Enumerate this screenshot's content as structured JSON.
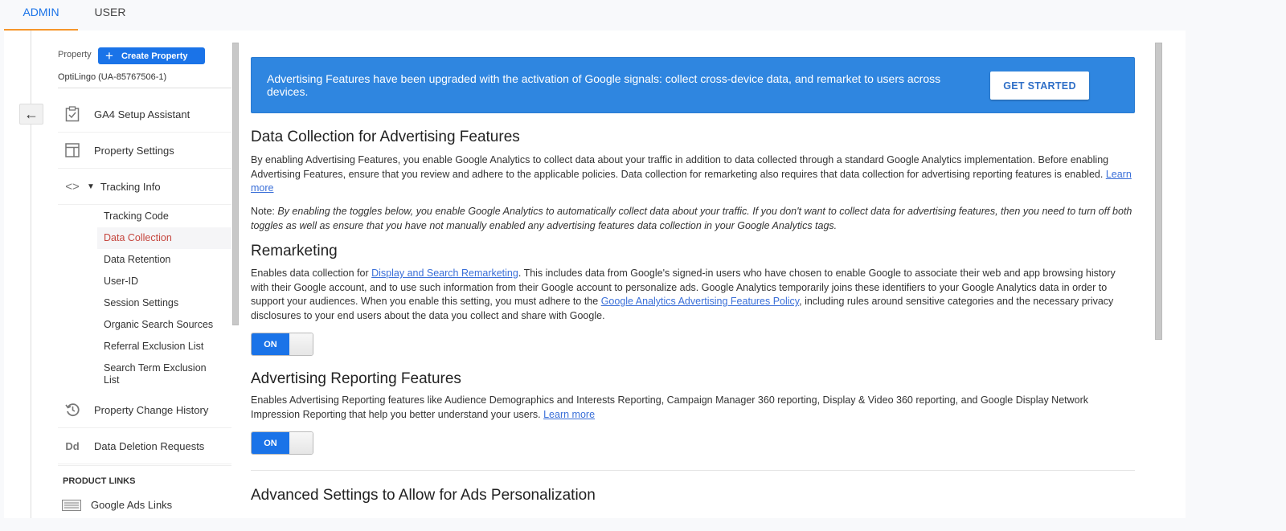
{
  "tabs": [
    {
      "label": "ADMIN",
      "active": true
    },
    {
      "label": "USER",
      "active": false
    }
  ],
  "sidebar": {
    "property_label": "Property",
    "create_button": "Create Property",
    "property_name": "OptiLingo (UA-85767506-1)",
    "items": [
      {
        "label": "GA4 Setup Assistant",
        "icon": "clipboard-check-icon"
      },
      {
        "label": "Property Settings",
        "icon": "layout-icon"
      },
      {
        "label": "Tracking Info",
        "icon": "code-icon",
        "expanded": true
      },
      {
        "label": "Property Change History",
        "icon": "history-icon"
      },
      {
        "label": "Data Deletion Requests",
        "icon": "dd-icon",
        "icon_text": "Dd"
      }
    ],
    "tracking_subitems": [
      {
        "label": "Tracking Code",
        "active": false
      },
      {
        "label": "Data Collection",
        "active": true
      },
      {
        "label": "Data Retention",
        "active": false
      },
      {
        "label": "User-ID",
        "active": false
      },
      {
        "label": "Session Settings",
        "active": false
      },
      {
        "label": "Organic Search Sources",
        "active": false
      },
      {
        "label": "Referral Exclusion List",
        "active": false
      },
      {
        "label": "Search Term Exclusion List",
        "active": false
      }
    ],
    "section_label": "PRODUCT LINKS",
    "product_links": [
      {
        "label": "Google Ads Links",
        "icon": "ads-links-icon"
      }
    ]
  },
  "banner": {
    "text": "Advertising Features have been upgraded with the activation of Google signals: collect cross-device data, and remarket to users across devices.",
    "button": "GET STARTED"
  },
  "sections": {
    "data_collection": {
      "title": "Data Collection for Advertising Features",
      "body": "By enabling Advertising Features, you enable Google Analytics to collect data about your traffic in addition to data collected through a standard Google Analytics implementation. Before enabling Advertising Features, ensure that you review and adhere to the applicable policies. Data collection for remarketing also requires that data collection for advertising reporting features is enabled.",
      "link": "Learn more",
      "note_label": "Note:",
      "note_text": "By enabling the toggles below, you enable Google Analytics to automatically collect data about your traffic. If you don't want to collect data for advertising features, then you need to turn off both toggles as well as ensure that you have not manually enabled any advertising features data collection in your Google Analytics tags."
    },
    "remarketing": {
      "title": "Remarketing",
      "body_1": "Enables data collection for",
      "link_1": "Display and Search Remarketing",
      "body_2": ". This includes data from Google's signed-in users who have chosen to enable Google to associate their web and app browsing history with their Google account, and to use such information from their Google account to personalize ads. Google Analytics temporarily joins these identifiers to your Google Analytics data in order to support your audiences. When you enable this setting, you must adhere to the",
      "link_2": "Google Analytics Advertising Features Policy",
      "body_3": ", including rules around sensitive categories and the necessary privacy disclosures to your end users about the data you collect and share with Google.",
      "toggle": "ON"
    },
    "reporting": {
      "title": "Advertising Reporting Features",
      "body": "Enables Advertising Reporting features like Audience Demographics and Interests Reporting, Campaign Manager 360 reporting, Display & Video 360 reporting, and Google Display Network Impression Reporting that help you better understand your users.",
      "link": "Learn more",
      "toggle": "ON"
    },
    "advanced": {
      "title": "Advanced Settings to Allow for Ads Personalization"
    }
  },
  "colors": {
    "accent": "#1a73e8",
    "banner": "#2f86e0",
    "active_nav": "#c5453d",
    "tab_underline": "#f5962b"
  }
}
